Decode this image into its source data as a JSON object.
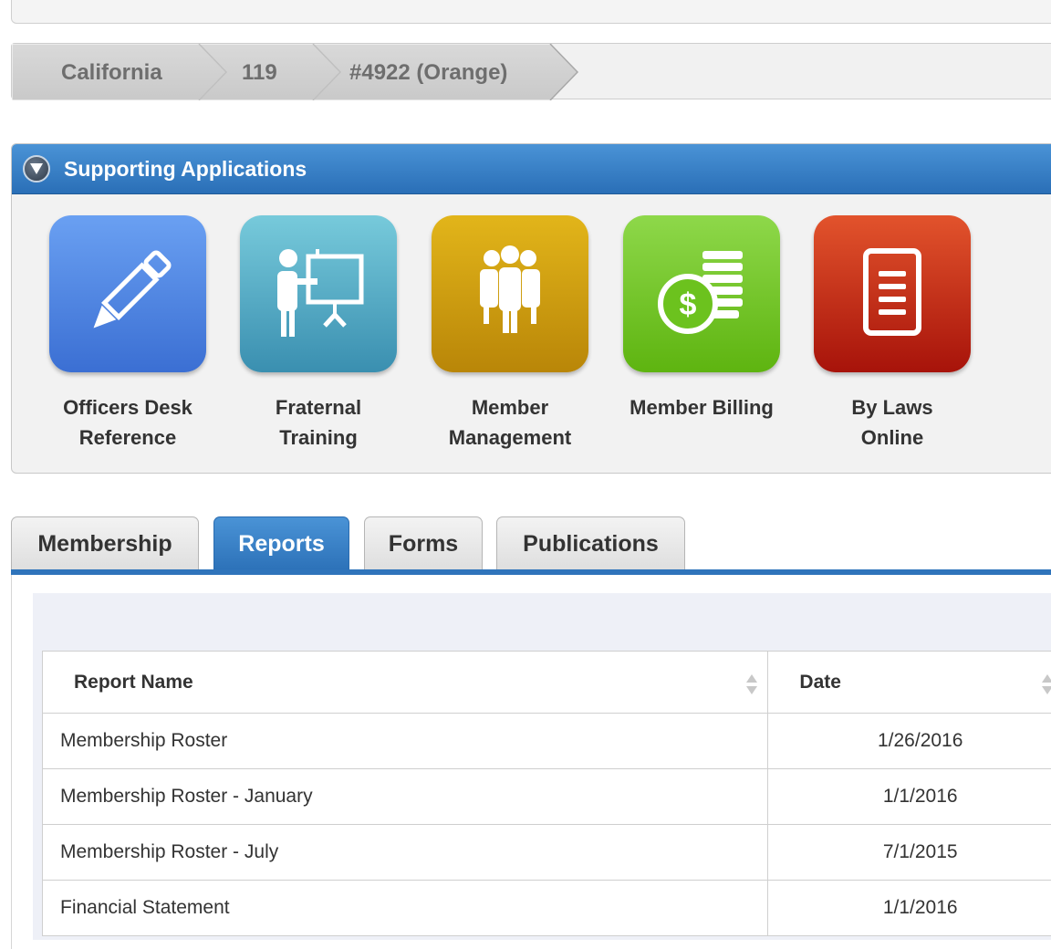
{
  "breadcrumb": {
    "items": [
      "California",
      "119",
      "#4922 (Orange)"
    ]
  },
  "supporting_apps": {
    "title": "Supporting Applications",
    "apps": [
      {
        "line1": "Officers Desk",
        "line2": "Reference",
        "icon": "pencil-icon",
        "color": "#4a7fdf"
      },
      {
        "line1": "Fraternal",
        "line2": "Training",
        "icon": "presentation-icon",
        "color": "#4aa2bd"
      },
      {
        "line1": "Member",
        "line2": "Management",
        "icon": "group-icon",
        "color": "#c99a0b"
      },
      {
        "line1": "Member Billing",
        "line2": "",
        "icon": "money-stack-icon",
        "color": "#6cc21e"
      },
      {
        "line1": "By Laws",
        "line2": "Online",
        "icon": "document-icon",
        "color": "#c9230f"
      }
    ]
  },
  "tabs": [
    {
      "label": "Membership",
      "active": false
    },
    {
      "label": "Reports",
      "active": true
    },
    {
      "label": "Forms",
      "active": false
    },
    {
      "label": "Publications",
      "active": false
    }
  ],
  "reports_table": {
    "columns": [
      "Report Name",
      "Date"
    ],
    "rows": [
      {
        "name": "Membership Roster",
        "date": "1/26/2016"
      },
      {
        "name": "Membership Roster - January",
        "date": "1/1/2016"
      },
      {
        "name": "Membership Roster - July",
        "date": "7/1/2015"
      },
      {
        "name": "Financial Statement",
        "date": "1/1/2016"
      }
    ]
  }
}
